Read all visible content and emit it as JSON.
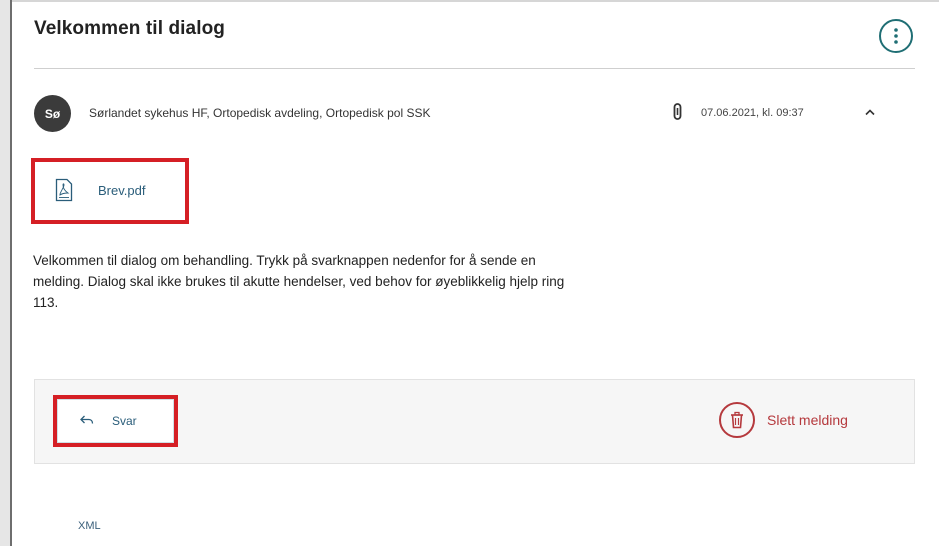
{
  "dialog": {
    "title": "Velkommen til dialog",
    "menu_icon": "vertical-dots-icon"
  },
  "message": {
    "avatar_initials": "Sø",
    "sender": "Sørlandet sykehus HF, Ortopedisk avdeling, Ortopedisk pol SSK",
    "attachment_indicator_icon": "paperclip-icon",
    "date": "07.06.2021, kl. 09:37",
    "collapse_icon": "chevron-up-icon",
    "attachment": {
      "icon": "pdf-file-icon",
      "filename": "Brev.pdf"
    },
    "body": "Velkommen til dialog om behandling. Trykk på svarknappen nedenfor for å sende en melding. Dialog skal ikke brukes til akutte hendelser, ved behov for øyeblikkelig hjelp ring 113."
  },
  "actions": {
    "reply_label": "Svar",
    "reply_icon": "reply-arrow-icon",
    "delete_label": "Slett melding",
    "delete_icon": "trash-icon"
  },
  "footer": {
    "xml_link": "XML"
  },
  "colors": {
    "accent_teal": "#1f6e74",
    "link_blue": "#2a5d7a",
    "danger_red": "#b5393d",
    "highlight_red": "#d51f25",
    "avatar_bg": "#3b3b3b"
  }
}
